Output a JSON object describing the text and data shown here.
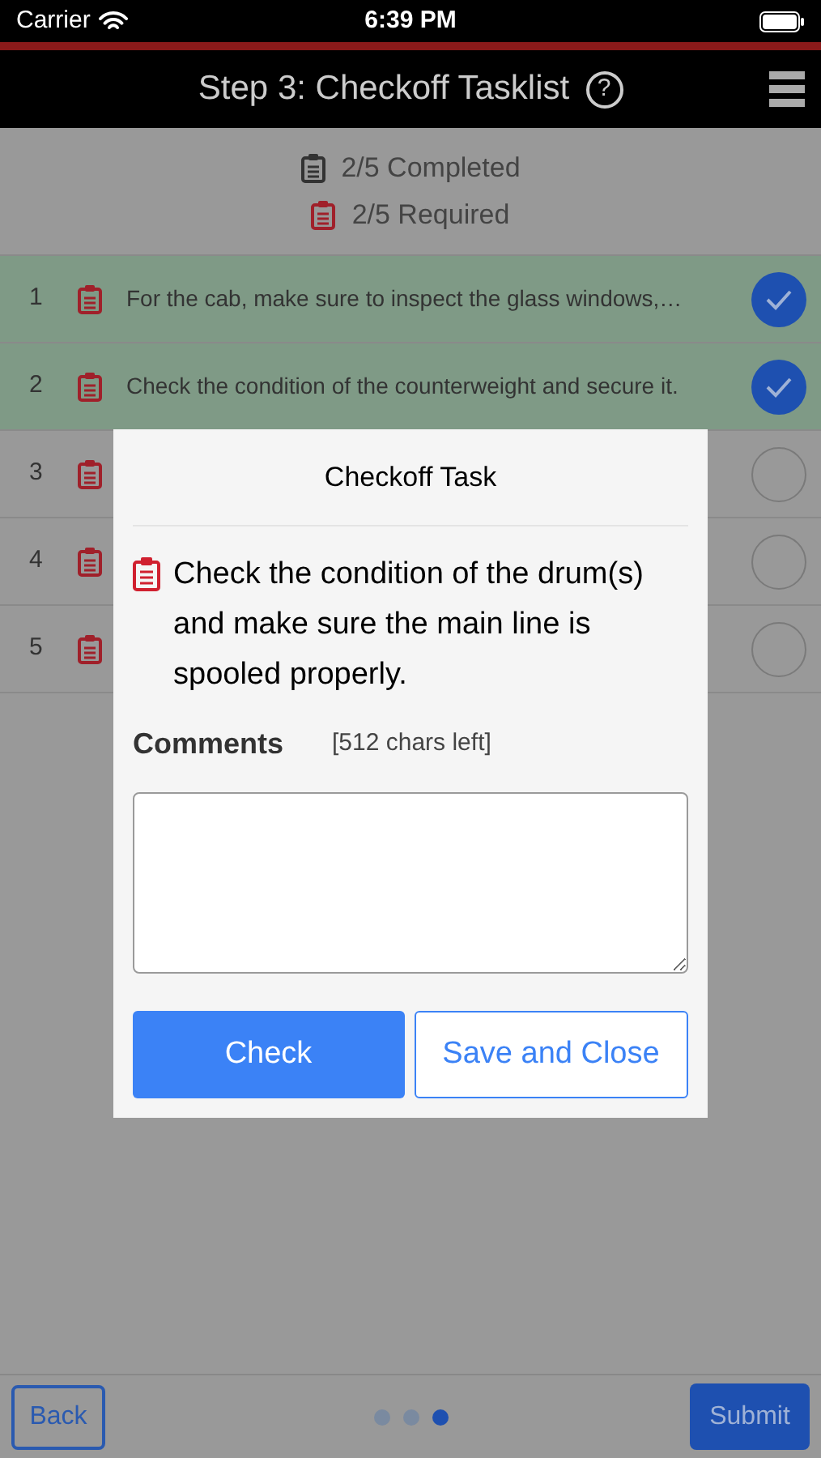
{
  "status_bar": {
    "carrier": "Carrier",
    "time": "6:39 PM"
  },
  "header": {
    "title": "Step 3: Checkoff Tasklist",
    "help": "?"
  },
  "summary": [
    {
      "kind": "completed",
      "text": "2/5 Completed"
    },
    {
      "kind": "required",
      "text": "2/5 Required"
    }
  ],
  "tasks": [
    {
      "number": "1",
      "text": "For the cab, make sure to inspect the glass windows,…",
      "checked": true
    },
    {
      "number": "2",
      "text": "Check the condition of the counterweight and secure it.",
      "checked": true
    },
    {
      "number": "3",
      "checked": false
    },
    {
      "number": "4",
      "checked": false
    },
    {
      "number": "5",
      "checked": false
    }
  ],
  "dialog": {
    "title": "Checkoff Task",
    "task_text": "Check the condition of the drum(s) and make sure the main line is spooled properly.",
    "comments_label": "Comments",
    "chars_left": "[512 chars left]",
    "buttons": [
      {
        "kind": "primary",
        "label": "Check"
      },
      {
        "kind": "outline",
        "label": "Save and Close"
      }
    ]
  },
  "footer": {
    "back": "Back",
    "submit": "Submit",
    "pages": [
      {
        "selected": false
      },
      {
        "selected": false
      },
      {
        "selected": true
      }
    ]
  }
}
